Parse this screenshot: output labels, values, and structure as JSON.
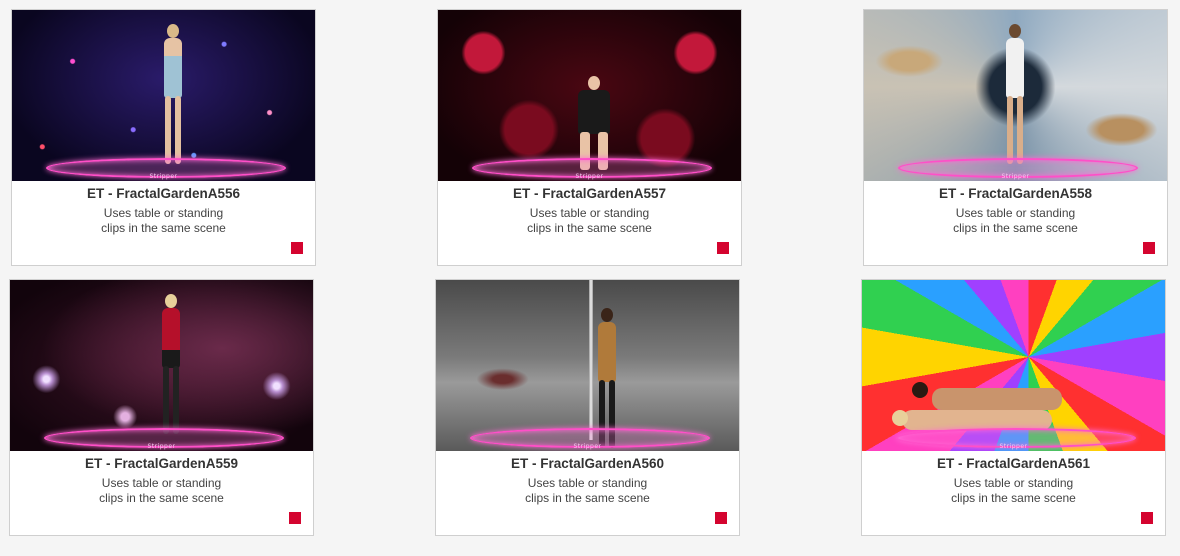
{
  "cards": [
    {
      "title": "ET - FractalGardenA556",
      "desc_line1": "Uses table or standing",
      "desc_line2": "clips in the same scene",
      "stage_label": "Stripper",
      "badge_color": "#d4042f"
    },
    {
      "title": "ET - FractalGardenA557",
      "desc_line1": "Uses table or standing",
      "desc_line2": "clips in the same scene",
      "stage_label": "Stripper",
      "badge_color": "#d4042f"
    },
    {
      "title": "ET - FractalGardenA558",
      "desc_line1": "Uses table or standing",
      "desc_line2": "clips in the same scene",
      "stage_label": "Stripper",
      "badge_color": "#d4042f"
    },
    {
      "title": "ET - FractalGardenA559",
      "desc_line1": "Uses table or standing",
      "desc_line2": "clips in the same scene",
      "stage_label": "Stripper",
      "badge_color": "#d4042f"
    },
    {
      "title": "ET - FractalGardenA560",
      "desc_line1": "Uses table or standing",
      "desc_line2": "clips in the same scene",
      "stage_label": "Stripper",
      "badge_color": "#d4042f"
    },
    {
      "title": "ET - FractalGardenA561",
      "desc_line1": "Uses table or standing",
      "desc_line2": "clips in the same scene",
      "stage_label": "Stripper",
      "badge_color": "#d4042f"
    }
  ]
}
